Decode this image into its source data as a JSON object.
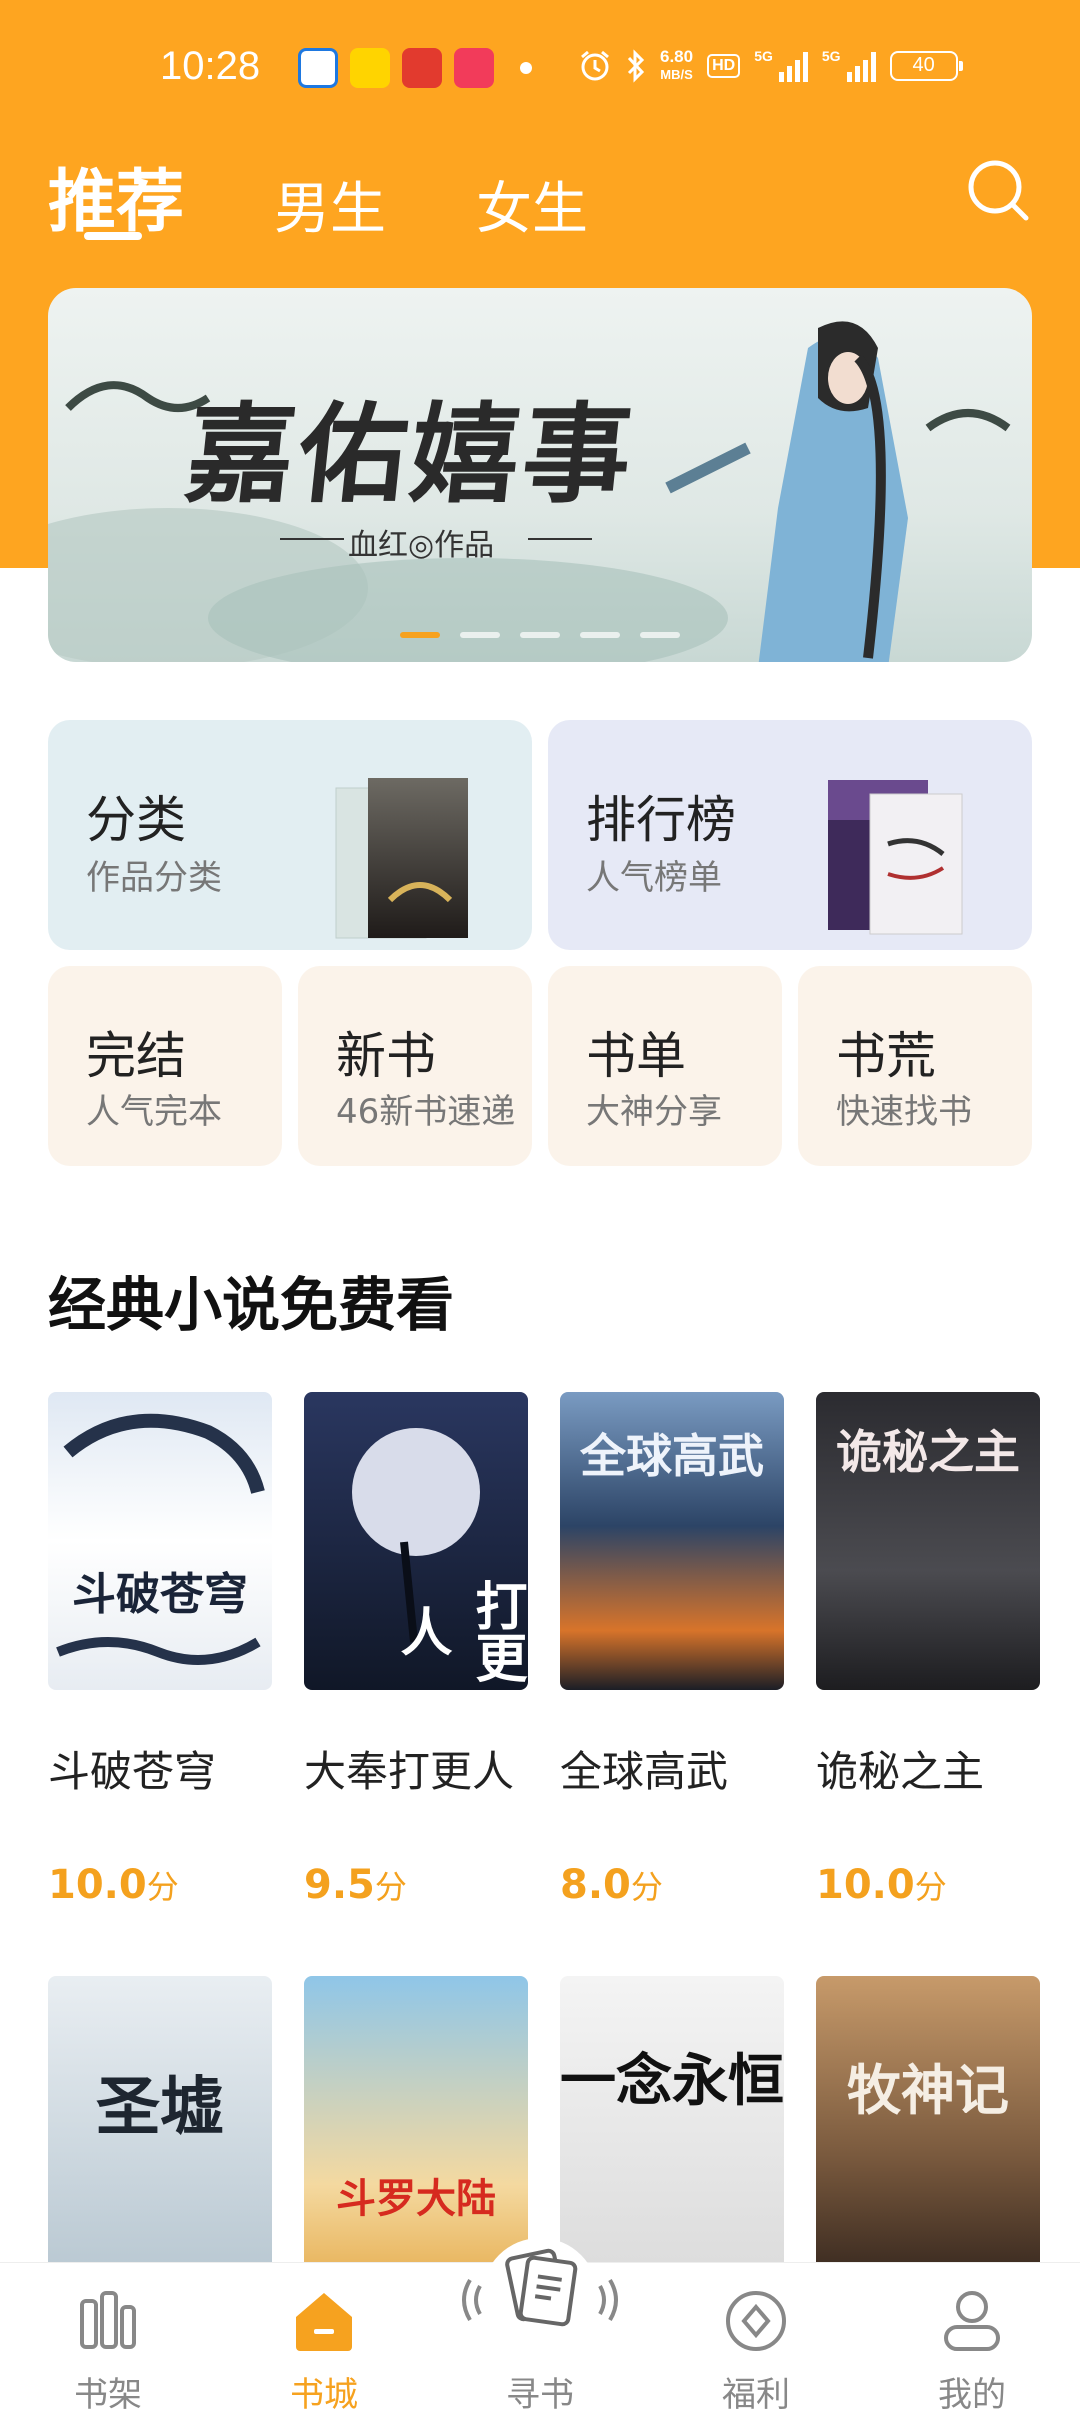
{
  "status_bar": {
    "time": "10:28",
    "net_speed_value": "6.80",
    "net_speed_unit": "MB/S",
    "hd_badge": "HD",
    "signal1_label": "5G",
    "signal2_label": "5G",
    "battery": "40"
  },
  "top_tabs": [
    {
      "label": "推荐",
      "active": true
    },
    {
      "label": "男生",
      "active": false
    },
    {
      "label": "女生",
      "active": false
    }
  ],
  "banner": {
    "title": "嘉佑嬉事",
    "author": "血红◎作品",
    "slide_count": 5,
    "active_slide": 0
  },
  "categories": {
    "classify": {
      "title": "分类",
      "subtitle": "作品分类",
      "bg": "#e2eef2"
    },
    "ranking": {
      "title": "排行榜",
      "subtitle": "人气榜单",
      "bg": "#e6e9f6"
    },
    "finished": {
      "title": "完结",
      "subtitle": "人气完本"
    },
    "newbooks": {
      "title": "新书",
      "subtitle": "46新书速递"
    },
    "booklist": {
      "title": "书单",
      "subtitle": "大神分享"
    },
    "bookfamine": {
      "title": "书荒",
      "subtitle": "快速找书"
    }
  },
  "section": {
    "title": "经典小说免费看"
  },
  "books_row1": [
    {
      "title": "斗破苍穹",
      "cover_text": "斗破苍穹",
      "score": "10.0",
      "unit": "分"
    },
    {
      "title": "大奉打更人",
      "cover_text": "打更人",
      "score": "9.5",
      "unit": "分"
    },
    {
      "title": "全球高武",
      "cover_text": "全球高武",
      "score": "8.0",
      "unit": "分"
    },
    {
      "title": "诡秘之主",
      "cover_text": "诡秘之主",
      "score": "10.0",
      "unit": "分"
    }
  ],
  "books_row2": [
    {
      "cover_text": "圣墟"
    },
    {
      "cover_text": "斗罗大陆"
    },
    {
      "cover_text": "一念永恒"
    },
    {
      "cover_text": "牧神记"
    }
  ],
  "bottom_nav": [
    {
      "label": "书架",
      "icon": "bookshelf-icon",
      "active": false
    },
    {
      "label": "书城",
      "icon": "bookstore-icon",
      "active": true
    },
    {
      "label": "寻书",
      "icon": "find-book-icon",
      "active": false
    },
    {
      "label": "福利",
      "icon": "welfare-icon",
      "active": false
    },
    {
      "label": "我的",
      "icon": "profile-icon",
      "active": false
    }
  ],
  "colors": {
    "brand_orange": "#fea520",
    "accent": "#f6a21f",
    "score": "#f4a11e"
  }
}
